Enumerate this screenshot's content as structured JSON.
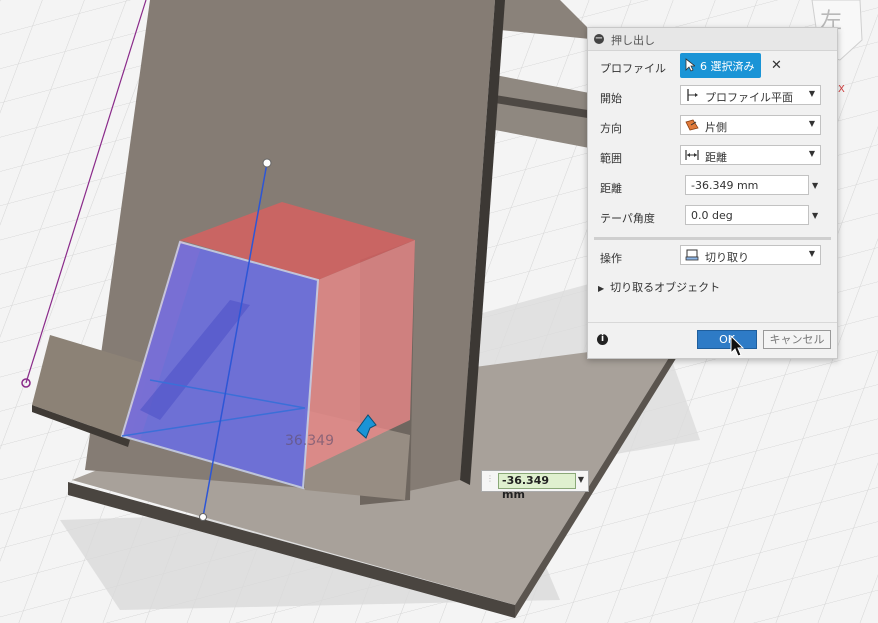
{
  "dialog": {
    "title": "押し出し",
    "rows": {
      "profile": {
        "label": "プロファイル",
        "selection": "6 選択済み"
      },
      "start": {
        "label": "開始",
        "value": "プロファイル平面"
      },
      "direction": {
        "label": "方向",
        "value": "片側"
      },
      "extent": {
        "label": "範囲",
        "value": "距離"
      },
      "distance": {
        "label": "距離",
        "value": "-36.349 mm"
      },
      "taper": {
        "label": "テーパ角度",
        "value": "0.0 deg"
      },
      "operation": {
        "label": "操作",
        "value": "切り取り"
      }
    },
    "objects_to_cut": "切り取るオブジェクト",
    "ok": "OK",
    "cancel": "キャンセル"
  },
  "viewport": {
    "dimension_input": "-36.349 mm",
    "dimension_label": "36.349"
  },
  "colors": {
    "accent": "#1a94d6",
    "ok_button": "#2e7bc6",
    "profile_blue": "#6b6fe6",
    "cut_red": "#e58585",
    "body_brown": "#8c8278"
  }
}
